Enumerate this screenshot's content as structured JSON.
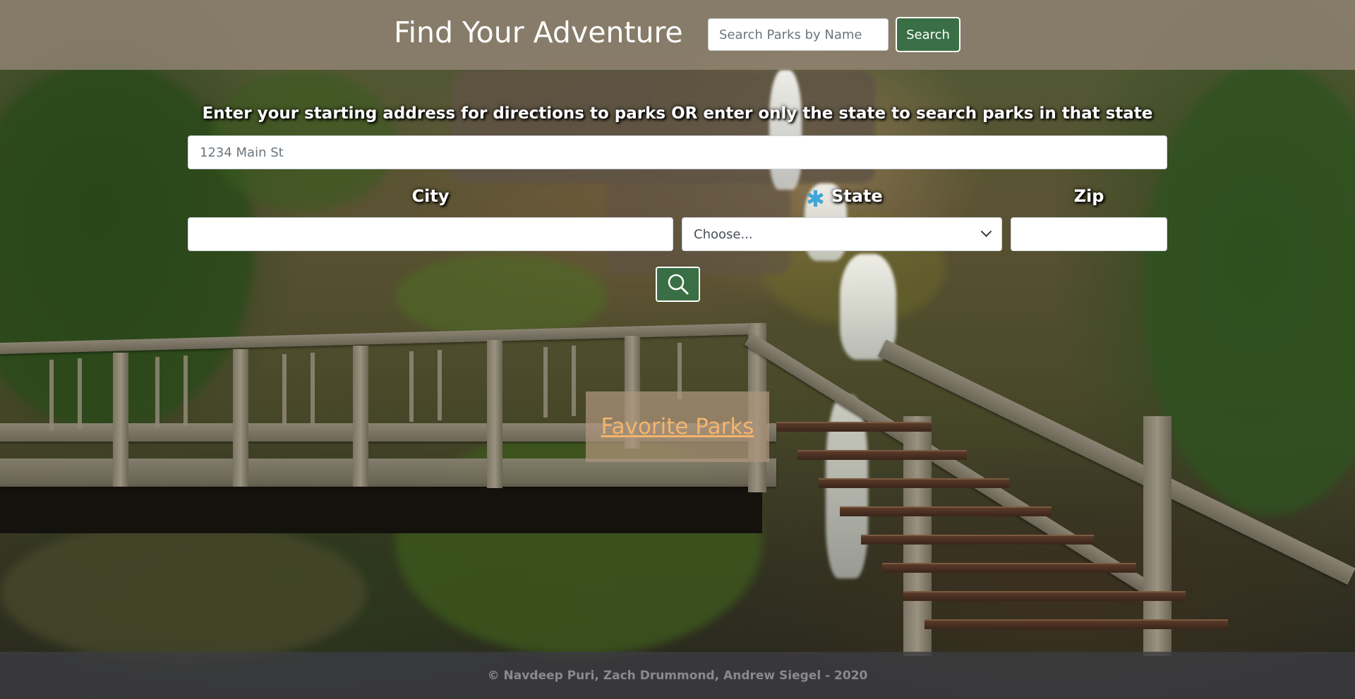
{
  "header": {
    "title": "Find Your Adventure",
    "search_placeholder": "Search Parks by Name",
    "search_label": "Search",
    "bg_color": "#968778"
  },
  "form": {
    "instructions": "Enter your starting address for directions to parks OR enter only the state to search parks in that state",
    "address_placeholder": "1234 Main St",
    "city_label": "City",
    "state_label": "State",
    "zip_label": "Zip",
    "state_selected": "Choose...",
    "city_value": "",
    "zip_value": "",
    "submit_icon": "search-icon",
    "required_icon": "asterisk-icon",
    "button_color": "#3a6f45"
  },
  "favorites": {
    "label": "Favorite Parks",
    "link_color": "#f3b46b"
  },
  "footer": {
    "text": "© Navdeep Puri, Zach Drummond, Andrew Siegel - 2020"
  },
  "background": {
    "scene": "waterfall-bridge-photo"
  }
}
